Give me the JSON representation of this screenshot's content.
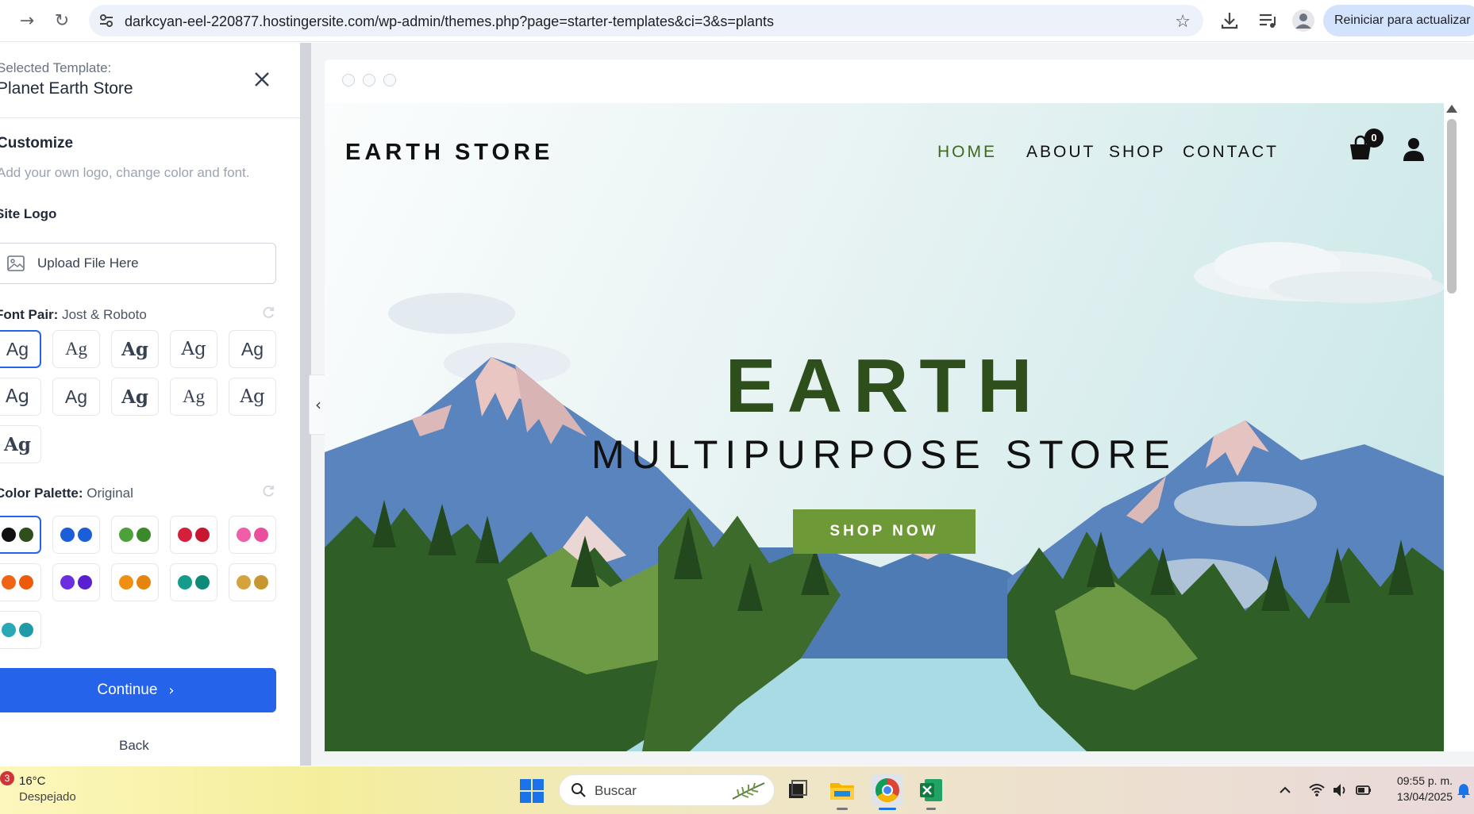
{
  "browser": {
    "url": "darkcyan-eel-220877.hostingersite.com/wp-admin/themes.php?page=starter-templates&ci=3&s=plants",
    "update_button": "Reiniciar para actualizar"
  },
  "panel": {
    "selected_label": "Selected Template:",
    "selected_name": "Planet Earth Store",
    "customize_title": "Customize",
    "customize_subtitle": "Add your own logo, change color and font.",
    "site_logo_label": "Site Logo",
    "upload_text": "Upload File Here",
    "font_pair_label": "Font Pair:",
    "font_pair_value": "Jost & Roboto",
    "font_swatches": [
      "Ag",
      "Ag",
      "Ag",
      "Ag",
      "Ag",
      "Ag",
      "Ag",
      "Ag",
      "Ag",
      "Ag",
      "Ag"
    ],
    "color_palette_label": "Color Palette:",
    "color_palette_value": "Original",
    "palettes": [
      [
        "#111111",
        "#2e4e1c"
      ],
      [
        "#1a5fd8",
        "#1a5fd8"
      ],
      [
        "#4ea03a",
        "#3a8a2c"
      ],
      [
        "#d61f3b",
        "#c7162f"
      ],
      [
        "#ee5fa8",
        "#ea4f9d"
      ],
      [
        "#f06515",
        "#ec5a0a"
      ],
      [
        "#6b2ee0",
        "#5a1fd1"
      ],
      [
        "#f09012",
        "#e6850c"
      ],
      [
        "#169c8a",
        "#0e8a78"
      ],
      [
        "#d4a33c",
        "#c7962f"
      ],
      [
        "#29a9b6",
        "#1f9aa8"
      ]
    ],
    "continue_label": "Continue",
    "back_label": "Back"
  },
  "site": {
    "logo": "EARTH STORE",
    "nav": [
      "HOME",
      "ABOUT",
      "SHOP",
      "CONTACT"
    ],
    "cart_count": "0",
    "hero_title": "EARTH",
    "hero_subtitle": "MULTIPURPOSE STORE",
    "cta": "SHOP NOW",
    "accent": "#6d9a36"
  },
  "taskbar": {
    "weather_badge": "3",
    "weather_temp": "16°C",
    "weather_desc": "Despejado",
    "search_placeholder": "Buscar",
    "time": "09:55 p. m.",
    "date": "13/04/2025"
  }
}
